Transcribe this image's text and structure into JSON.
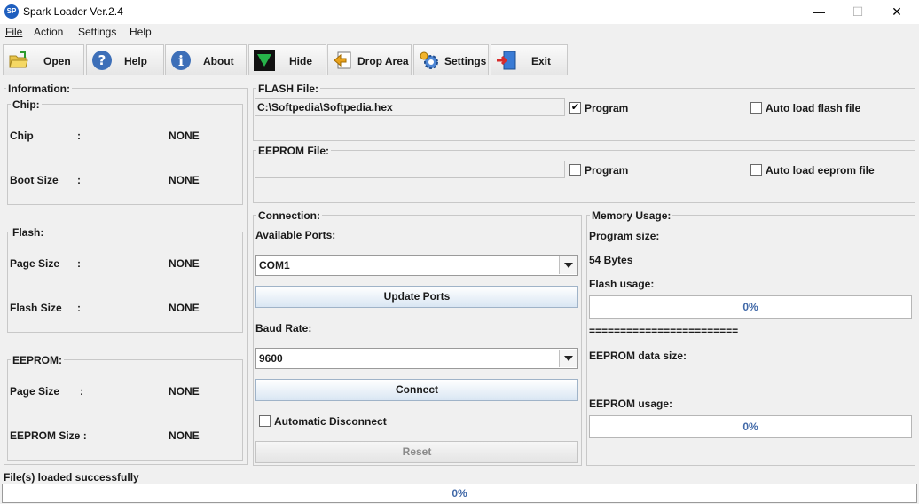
{
  "window": {
    "title": "Spark Loader Ver.2.4",
    "app_icon_text": "SP",
    "minimize_glyph": "—",
    "maximize_glyph": "☐",
    "close_glyph": "✕"
  },
  "menu": {
    "file": "File",
    "action": "Action",
    "settings": "Settings",
    "help": "Help"
  },
  "toolbar": {
    "open": "Open",
    "help": "Help",
    "about": "About",
    "hide": "Hide",
    "drop_area": "Drop Area",
    "settings": "Settings",
    "exit": "Exit"
  },
  "information": {
    "title": "Information:",
    "chip": {
      "title": "Chip:",
      "rows": [
        {
          "label": "Chip",
          "sep": ":",
          "value": "NONE"
        },
        {
          "label": "Boot Size",
          "sep": ":",
          "value": "NONE"
        }
      ]
    },
    "flash": {
      "title": "Flash:",
      "rows": [
        {
          "label": "Page Size",
          "sep": ":",
          "value": "NONE"
        },
        {
          "label": "Flash Size",
          "sep": ":",
          "value": "NONE"
        }
      ]
    },
    "eeprom": {
      "title": "EEPROM:",
      "rows": [
        {
          "label": "Page Size",
          "sep": ":",
          "value": "NONE"
        },
        {
          "label": "EEPROM Size :",
          "sep": "",
          "value": "NONE"
        }
      ]
    }
  },
  "flash_file": {
    "title": "FLASH File:",
    "path": "C:\\Softpedia\\Softpedia.hex",
    "program_label": "Program",
    "program_checked": true,
    "auto_load_label": "Auto load flash file",
    "auto_load_checked": false
  },
  "eeprom_file": {
    "title": "EEPROM File:",
    "path": "",
    "program_label": "Program",
    "program_checked": false,
    "auto_load_label": "Auto load eeprom file",
    "auto_load_checked": false
  },
  "connection": {
    "title": "Connection:",
    "ports_label": "Available Ports:",
    "port_selected": "COM1",
    "update_ports": "Update Ports",
    "baud_label": "Baud Rate:",
    "baud_selected": "9600",
    "connect": "Connect",
    "auto_disconnect_label": "Automatic Disconnect",
    "auto_disconnect_checked": false,
    "reset": "Reset"
  },
  "memory": {
    "title": "Memory Usage:",
    "program_size_label": "Program size:",
    "program_size_value": "54 Bytes",
    "flash_usage_label": "Flash usage:",
    "flash_usage_text": "0%",
    "separator": "========================",
    "eeprom_data_size_label": "EEPROM data size:",
    "eeprom_usage_label": "EEPROM usage:",
    "eeprom_usage_text": "0%"
  },
  "status": {
    "message": "File(s) loaded successfully",
    "progress_text": "0%"
  },
  "colors": {
    "accent": "#4169a8",
    "background": "#f0f0f0"
  }
}
